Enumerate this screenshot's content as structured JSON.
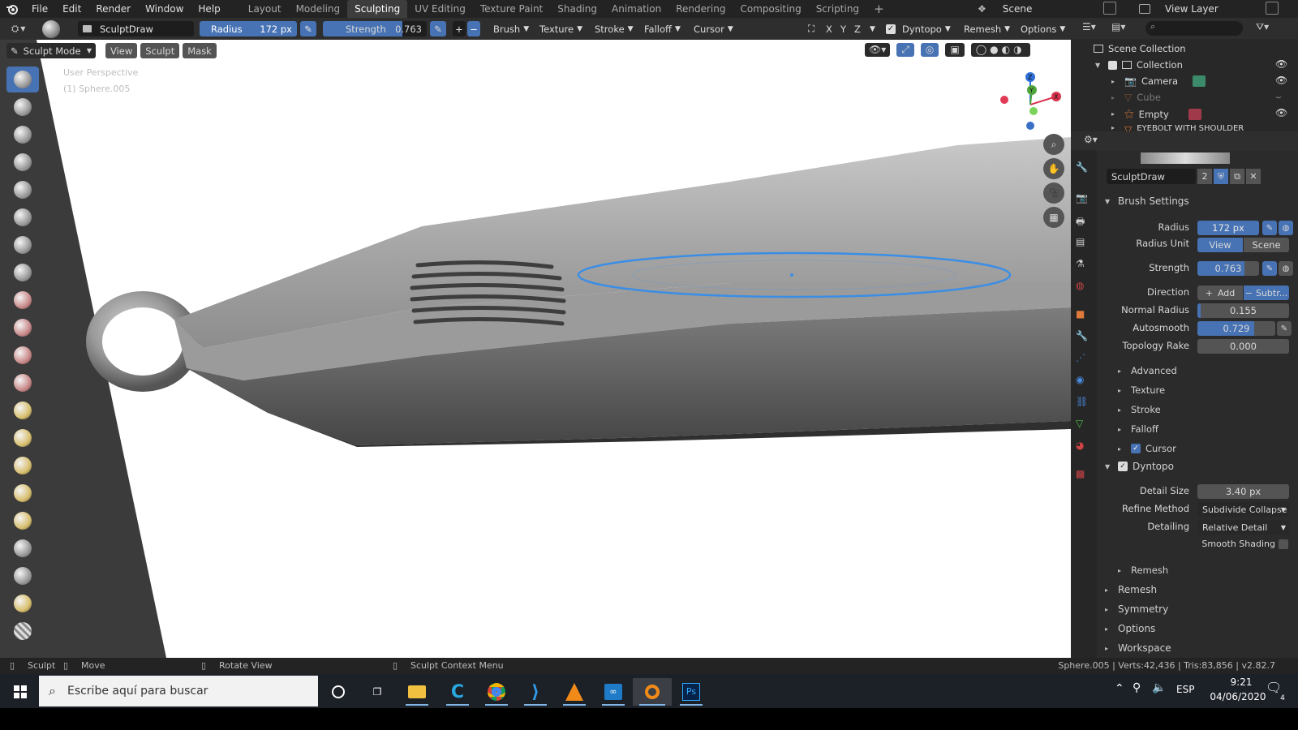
{
  "menu": [
    "File",
    "Edit",
    "Render",
    "Window",
    "Help"
  ],
  "workspaces": [
    "Layout",
    "Modeling",
    "Sculpting",
    "UV Editing",
    "Texture Paint",
    "Shading",
    "Animation",
    "Rendering",
    "Compositing",
    "Scripting"
  ],
  "active_workspace": "Sculpting",
  "scene_name": "Scene",
  "view_layer": "View Layer",
  "header": {
    "brush_name": "SculptDraw",
    "radius_label": "Radius",
    "radius_value": "172 px",
    "strength_label": "Strength",
    "strength_value": "0.763",
    "brush_menu": "Brush",
    "texture_menu": "Texture",
    "stroke_menu": "Stroke",
    "falloff_menu": "Falloff",
    "cursor_menu": "Cursor",
    "x": "X",
    "y": "Y",
    "z": "Z",
    "dyntopo": "Dyntopo",
    "remesh": "Remesh",
    "options": "Options"
  },
  "mode_bar": {
    "mode": "Sculpt Mode",
    "view": "View",
    "sculpt": "Sculpt",
    "mask": "Mask"
  },
  "viewport": {
    "perspective": "User Perspective",
    "object_info": "(1) Sphere.005"
  },
  "outliner": {
    "root": "Scene Collection",
    "collection": "Collection",
    "items": [
      "Camera",
      "Cube",
      "Empty",
      "EYEBOLT WITH SHOULDER"
    ]
  },
  "properties": {
    "brush_slot_name": "SculptDraw",
    "brush_users": "2",
    "brush_settings_title": "Brush Settings",
    "radius_label": "Radius",
    "radius_value": "172 px",
    "radius_unit_label": "Radius Unit",
    "radius_unit_view": "View",
    "radius_unit_scene": "Scene",
    "strength_label": "Strength",
    "strength_value": "0.763",
    "strength_fraction": 0.763,
    "direction_label": "Direction",
    "direction_add": "Add",
    "direction_sub": "Subtr...",
    "normal_radius_label": "Normal Radius",
    "normal_radius_value": "0.155",
    "autosmooth_label": "Autosmooth",
    "autosmooth_value": "0.729",
    "autosmooth_fraction": 0.729,
    "topology_rake_label": "Topology Rake",
    "topology_rake_value": "0.000",
    "sub_sections": [
      "Advanced",
      "Texture",
      "Stroke",
      "Falloff",
      "Cursor"
    ],
    "dyntopo_title": "Dyntopo",
    "detail_size_label": "Detail Size",
    "detail_size_value": "3.40 px",
    "refine_method_label": "Refine Method",
    "refine_method_value": "Subdivide Collapse",
    "detailing_label": "Detailing",
    "detailing_value": "Relative Detail",
    "smooth_shading_label": "Smooth Shading",
    "remesh_sub": "Remesh",
    "bottom_sections": [
      "Remesh",
      "Symmetry",
      "Options",
      "Workspace"
    ]
  },
  "statusbar": {
    "sculpt": "Sculpt",
    "move": "Move",
    "rotate": "Rotate View",
    "context": "Sculpt Context Menu",
    "stats": "Sphere.005 | Verts:42,436 | Tris:83,856 | v2.82.7"
  },
  "taskbar": {
    "search_placeholder": "Escribe aquí para buscar",
    "lang": "ESP",
    "time": "9:21",
    "date": "04/06/2020",
    "notif_count": "4"
  },
  "colors": {
    "accent": "#4772b3",
    "brush_ring": "#3a8ee6"
  }
}
